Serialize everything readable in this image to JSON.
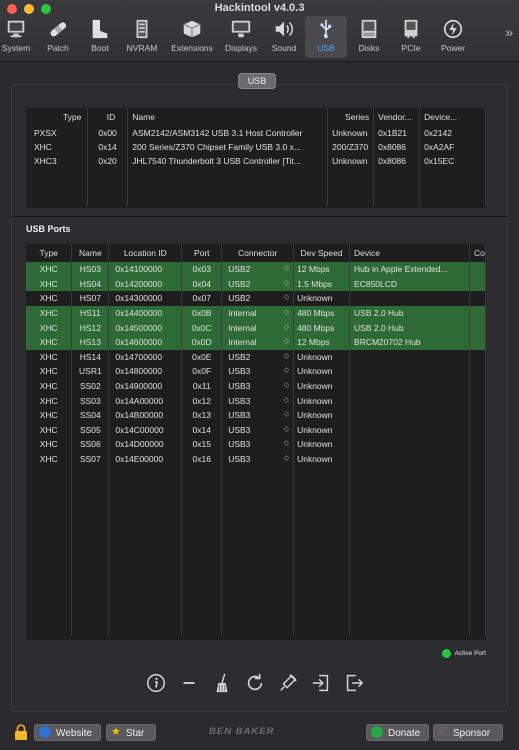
{
  "window": {
    "title": "Hackintool v4.0.3"
  },
  "toolbar": {
    "items": [
      {
        "label": "System",
        "icon": "monitor-icon"
      },
      {
        "label": "Patch",
        "icon": "bandage-icon"
      },
      {
        "label": "Boot",
        "icon": "boot-icon"
      },
      {
        "label": "NVRAM",
        "icon": "chip-icon"
      },
      {
        "label": "Extensions",
        "icon": "box-icon"
      },
      {
        "label": "Displays",
        "icon": "display-icon"
      },
      {
        "label": "Sound",
        "icon": "speaker-icon"
      },
      {
        "label": "USB",
        "icon": "usb-icon"
      },
      {
        "label": "Disks",
        "icon": "disk-icon"
      },
      {
        "label": "PCIe",
        "icon": "pcie-icon"
      },
      {
        "label": "Power",
        "icon": "power-icon"
      }
    ],
    "active": "USB",
    "more_label": "»"
  },
  "section_label": "USB",
  "controllers": {
    "columns": [
      "Type",
      "ID",
      "Name",
      "Series",
      "Vendor...",
      "Device..."
    ],
    "rows": [
      [
        "PXSX",
        "0x00",
        "ASM2142/ASM3142 USB 3.1 Host Controller",
        "Unknown",
        "0x1B21",
        "0x2142"
      ],
      [
        "XHC",
        "0x14",
        "200 Series/Z370 Chipset Family USB 3.0 x...",
        "200/Z370",
        "0x8086",
        "0xA2AF"
      ],
      [
        "XHC3",
        "0x20",
        "JHL7540 Thunderbolt 3 USB Controller [Tit...",
        "Unknown",
        "0x8086",
        "0x15EC"
      ]
    ]
  },
  "ports": {
    "title": "USB Ports",
    "columns": [
      "Type",
      "Name",
      "Location ID",
      "Port",
      "Connector",
      "Dev Speed",
      "Device",
      "Co"
    ],
    "rows": [
      {
        "type": "XHC",
        "name": "HS03",
        "loc": "0x14100000",
        "port": "0x03",
        "conn": "USB2",
        "speed": "12 Mbps",
        "device": "Hub in Apple Extended...",
        "active": true
      },
      {
        "type": "XHC",
        "name": "HS04",
        "loc": "0x14200000",
        "port": "0x04",
        "conn": "USB2",
        "speed": "1.5 Mbps",
        "device": "EC850LCD",
        "active": true
      },
      {
        "type": "XHC",
        "name": "HS07",
        "loc": "0x14300000",
        "port": "0x07",
        "conn": "USB2",
        "speed": "Unknown",
        "device": "",
        "active": false
      },
      {
        "type": "XHC",
        "name": "HS11",
        "loc": "0x14400000",
        "port": "0x0B",
        "conn": "Internal",
        "speed": "480 Mbps",
        "device": "USB 2.0 Hub",
        "active": true
      },
      {
        "type": "XHC",
        "name": "HS12",
        "loc": "0x14500000",
        "port": "0x0C",
        "conn": "Internal",
        "speed": "480 Mbps",
        "device": "USB 2.0 Hub",
        "active": true
      },
      {
        "type": "XHC",
        "name": "HS13",
        "loc": "0x14600000",
        "port": "0x0D",
        "conn": "Internal",
        "speed": "12 Mbps",
        "device": "BRCM20702 Hub",
        "active": true
      },
      {
        "type": "XHC",
        "name": "HS14",
        "loc": "0x14700000",
        "port": "0x0E",
        "conn": "USB2",
        "speed": "Unknown",
        "device": "",
        "active": false
      },
      {
        "type": "XHC",
        "name": "USR1",
        "loc": "0x14800000",
        "port": "0x0F",
        "conn": "USB3",
        "speed": "Unknown",
        "device": "",
        "active": false
      },
      {
        "type": "XHC",
        "name": "SS02",
        "loc": "0x14900000",
        "port": "0x11",
        "conn": "USB3",
        "speed": "Unknown",
        "device": "",
        "active": false
      },
      {
        "type": "XHC",
        "name": "SS03",
        "loc": "0x14A00000",
        "port": "0x12",
        "conn": "USB3",
        "speed": "Unknown",
        "device": "",
        "active": false
      },
      {
        "type": "XHC",
        "name": "SS04",
        "loc": "0x14B00000",
        "port": "0x13",
        "conn": "USB3",
        "speed": "Unknown",
        "device": "",
        "active": false
      },
      {
        "type": "XHC",
        "name": "SS05",
        "loc": "0x14C00000",
        "port": "0x14",
        "conn": "USB3",
        "speed": "Unknown",
        "device": "",
        "active": false
      },
      {
        "type": "XHC",
        "name": "SS06",
        "loc": "0x14D00000",
        "port": "0x15",
        "conn": "USB3",
        "speed": "Unknown",
        "device": "",
        "active": false
      },
      {
        "type": "XHC",
        "name": "SS07",
        "loc": "0x14E00000",
        "port": "0x16",
        "conn": "USB3",
        "speed": "Unknown",
        "device": "",
        "active": false
      }
    ]
  },
  "legend": {
    "label": "Active Port",
    "color": "#28c840"
  },
  "actions": [
    {
      "name": "info-icon"
    },
    {
      "name": "minus-icon"
    },
    {
      "name": "broom-icon"
    },
    {
      "name": "refresh-icon"
    },
    {
      "name": "injector-icon"
    },
    {
      "name": "import-icon"
    },
    {
      "name": "export-icon"
    }
  ],
  "footer": {
    "website_label": "Website",
    "star_label": "Star",
    "brand": "BEN BAKER",
    "donate_label": "Donate",
    "sponsor_label": "Sponsor"
  },
  "colors": {
    "active_row": "#2e6a36",
    "accent": "#4aa3ff"
  }
}
